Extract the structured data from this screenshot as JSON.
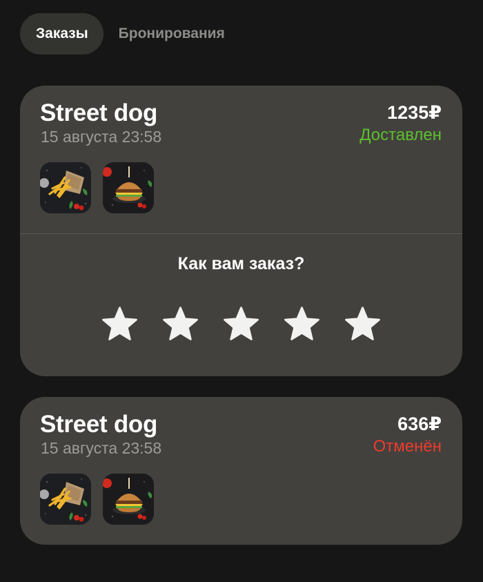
{
  "tabs": [
    {
      "label": "Заказы",
      "active": true
    },
    {
      "label": "Бронирования",
      "active": false
    }
  ],
  "orders": [
    {
      "restaurant": "Street dog",
      "date": "15 августа 23:58",
      "price": "1235₽",
      "status": "Доставлен",
      "status_color": "#5cc02e",
      "items": [
        {
          "icon": "fries-dish-photo"
        },
        {
          "icon": "burger-dish-photo"
        }
      ],
      "rating": {
        "question": "Как вам заказ?",
        "stars": 5,
        "selected": 0
      }
    },
    {
      "restaurant": "Street dog",
      "date": "15 августа 23:58",
      "price": "636₽",
      "status": "Отменён",
      "status_color": "#ef3b30",
      "items": [
        {
          "icon": "fries-dish-photo"
        },
        {
          "icon": "burger-dish-photo"
        }
      ]
    }
  ],
  "colors": {
    "background": "#161616",
    "card": "#42413d",
    "active_tab": "#333330"
  }
}
